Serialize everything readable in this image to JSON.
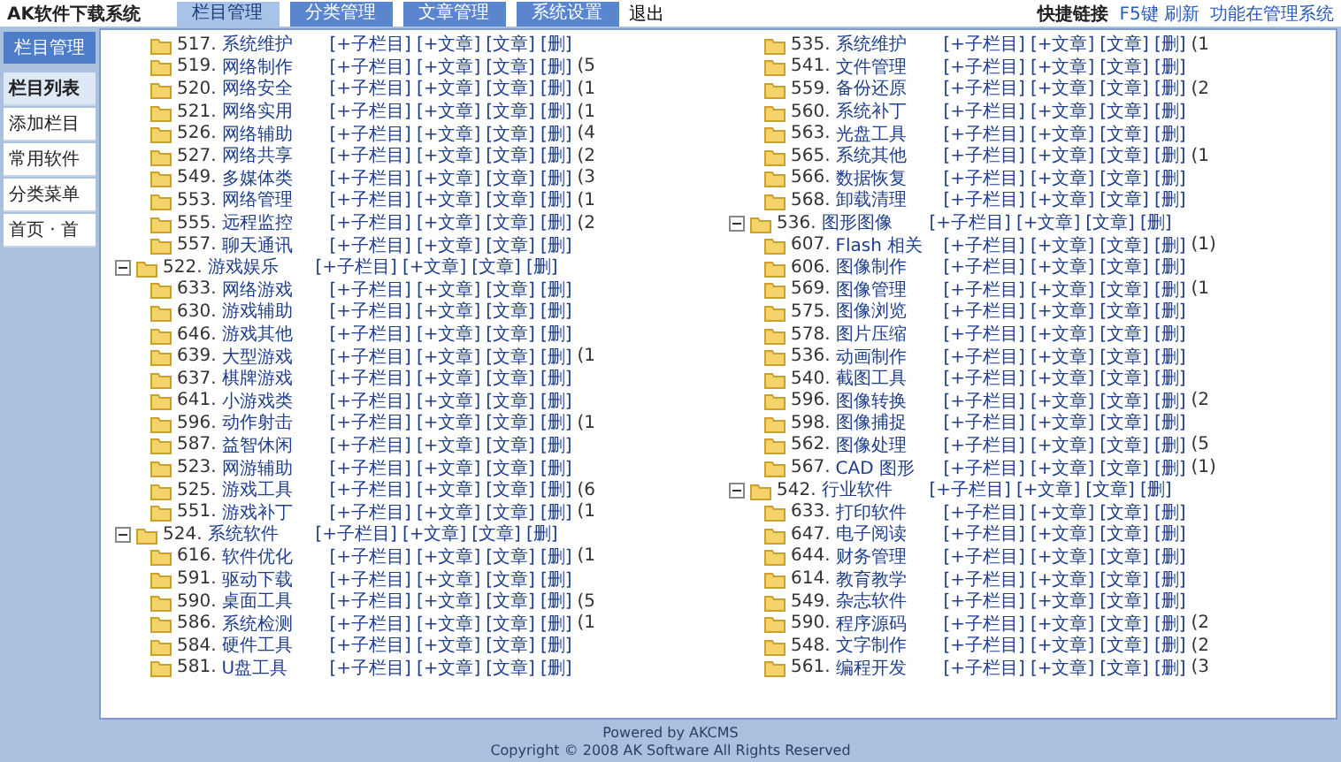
{
  "header": {
    "title": "AK软件下载系统",
    "tabs": [
      {
        "label": "栏目管理",
        "selected": true
      },
      {
        "label": "分类管理",
        "selected": false
      },
      {
        "label": "文章管理",
        "selected": false
      },
      {
        "label": "系统设置",
        "selected": false
      }
    ],
    "logout": "退出",
    "quick_label": "快捷链接",
    "quick_links": [
      "F5键 刷新",
      "功能在管理系统"
    ]
  },
  "sidebar": {
    "heading": "栏目管理",
    "items": [
      {
        "label": "栏目列表",
        "selected": true
      },
      {
        "label": "添加栏目",
        "selected": false
      },
      {
        "label": "常用软件",
        "selected": false
      },
      {
        "label": "分类菜单",
        "selected": false
      },
      {
        "label": "首页 · 首",
        "selected": false
      }
    ]
  },
  "tree": [
    {
      "children": [
        {
          "num": "517.",
          "name": "系统维护",
          "actions": [
            "[+子栏目]",
            "[+文章]",
            "[文章]",
            "[删]"
          ]
        },
        {
          "num": "519.",
          "name": "网络制作",
          "actions": [
            "[+子栏目]",
            "[+文章]",
            "[文章]",
            "[删]"
          ],
          "count": "(5"
        },
        {
          "num": "520.",
          "name": "网络安全",
          "actions": [
            "[+子栏目]",
            "[+文章]",
            "[文章]",
            "[删]"
          ],
          "count": "(1"
        },
        {
          "num": "521.",
          "name": "网络实用",
          "actions": [
            "[+子栏目]",
            "[+文章]",
            "[文章]",
            "[删]"
          ],
          "count": "(1"
        },
        {
          "num": "526.",
          "name": "网络辅助",
          "actions": [
            "[+子栏目]",
            "[+文章]",
            "[文章]",
            "[删]"
          ],
          "count": "(4"
        },
        {
          "num": "527.",
          "name": "网络共享",
          "actions": [
            "[+子栏目]",
            "[+文章]",
            "[文章]",
            "[删]"
          ],
          "count": "(2"
        },
        {
          "num": "549.",
          "name": "多媒体类",
          "actions": [
            "[+子栏目]",
            "[+文章]",
            "[文章]",
            "[删]"
          ],
          "count": "(3"
        },
        {
          "num": "553.",
          "name": "网络管理",
          "actions": [
            "[+子栏目]",
            "[+文章]",
            "[文章]",
            "[删]"
          ],
          "count": "(1"
        },
        {
          "num": "555.",
          "name": "远程监控",
          "actions": [
            "[+子栏目]",
            "[+文章]",
            "[文章]",
            "[删]"
          ],
          "count": "(2"
        },
        {
          "num": "557.",
          "name": "聊天通讯",
          "actions": [
            "[+子栏目]",
            "[+文章]",
            "[文章]",
            "[删]"
          ]
        }
      ]
    },
    {
      "num": "522.",
      "name": "游戏娱乐",
      "expanded": true,
      "actions": [
        "[+子栏目]",
        "[+文章]",
        "[文章]",
        "[删]"
      ],
      "children": [
        {
          "num": "633.",
          "name": "网络游戏",
          "actions": [
            "[+子栏目]",
            "[+文章]",
            "[文章]",
            "[删]"
          ]
        },
        {
          "num": "630.",
          "name": "游戏辅助",
          "actions": [
            "[+子栏目]",
            "[+文章]",
            "[文章]",
            "[删]"
          ]
        },
        {
          "num": "646.",
          "name": "游戏其他",
          "actions": [
            "[+子栏目]",
            "[+文章]",
            "[文章]",
            "[删]"
          ]
        },
        {
          "num": "639.",
          "name": "大型游戏",
          "actions": [
            "[+子栏目]",
            "[+文章]",
            "[文章]",
            "[删]"
          ],
          "count": "(1"
        },
        {
          "num": "637.",
          "name": "棋牌游戏",
          "actions": [
            "[+子栏目]",
            "[+文章]",
            "[文章]",
            "[删]"
          ]
        },
        {
          "num": "641.",
          "name": "小游戏类",
          "actions": [
            "[+子栏目]",
            "[+文章]",
            "[文章]",
            "[删]"
          ]
        },
        {
          "num": "596.",
          "name": "动作射击",
          "actions": [
            "[+子栏目]",
            "[+文章]",
            "[文章]",
            "[删]"
          ],
          "count": "(1"
        },
        {
          "num": "587.",
          "name": "益智休闲",
          "actions": [
            "[+子栏目]",
            "[+文章]",
            "[文章]",
            "[删]"
          ]
        },
        {
          "num": "523.",
          "name": "网游辅助",
          "actions": [
            "[+子栏目]",
            "[+文章]",
            "[文章]",
            "[删]"
          ]
        },
        {
          "num": "525.",
          "name": "游戏工具",
          "actions": [
            "[+子栏目]",
            "[+文章]",
            "[文章]",
            "[删]"
          ],
          "count": "(6"
        },
        {
          "num": "551.",
          "name": "游戏补丁",
          "actions": [
            "[+子栏目]",
            "[+文章]",
            "[文章]",
            "[删]"
          ],
          "count": "(1"
        }
      ]
    },
    {
      "num": "524.",
      "name": "系统软件",
      "expanded": true,
      "actions": [
        "[+子栏目]",
        "[+文章]",
        "[文章]",
        "[删]"
      ],
      "children": [
        {
          "num": "616.",
          "name": "软件优化",
          "actions": [
            "[+子栏目]",
            "[+文章]",
            "[文章]",
            "[删]"
          ],
          "count": "(1"
        },
        {
          "num": "591.",
          "name": "驱动下载",
          "actions": [
            "[+子栏目]",
            "[+文章]",
            "[文章]",
            "[删]"
          ]
        },
        {
          "num": "590.",
          "name": "桌面工具",
          "actions": [
            "[+子栏目]",
            "[+文章]",
            "[文章]",
            "[删]"
          ],
          "count": "(5"
        },
        {
          "num": "586.",
          "name": "系统检测",
          "actions": [
            "[+子栏目]",
            "[+文章]",
            "[文章]",
            "[删]"
          ],
          "count": "(1"
        },
        {
          "num": "584.",
          "name": "硬件工具",
          "actions": [
            "[+子栏目]",
            "[+文章]",
            "[文章]",
            "[删]"
          ]
        },
        {
          "num": "581.",
          "name": "U盘工具",
          "actions": [
            "[+子栏目]",
            "[+文章]",
            "[文章]",
            "[删]"
          ]
        },
        {
          "num": "535.",
          "name": "系统维护",
          "actions": [
            "[+子栏目]",
            "[+文章]",
            "[文章]",
            "[删]"
          ],
          "count": "(1"
        },
        {
          "num": "541.",
          "name": "文件管理",
          "actions": [
            "[+子栏目]",
            "[+文章]",
            "[文章]",
            "[删]"
          ]
        },
        {
          "num": "559.",
          "name": "备份还原",
          "actions": [
            "[+子栏目]",
            "[+文章]",
            "[文章]",
            "[删]"
          ],
          "count": "(2"
        },
        {
          "num": "560.",
          "name": "系统补丁",
          "actions": [
            "[+子栏目]",
            "[+文章]",
            "[文章]",
            "[删]"
          ]
        },
        {
          "num": "563.",
          "name": "光盘工具",
          "actions": [
            "[+子栏目]",
            "[+文章]",
            "[文章]",
            "[删]"
          ]
        },
        {
          "num": "565.",
          "name": "系统其他",
          "actions": [
            "[+子栏目]",
            "[+文章]",
            "[文章]",
            "[删]"
          ],
          "count": "(1"
        },
        {
          "num": "566.",
          "name": "数据恢复",
          "actions": [
            "[+子栏目]",
            "[+文章]",
            "[文章]",
            "[删]"
          ]
        },
        {
          "num": "568.",
          "name": "卸载清理",
          "actions": [
            "[+子栏目]",
            "[+文章]",
            "[文章]",
            "[删]"
          ]
        }
      ]
    },
    {
      "num": "536.",
      "name": "图形图像",
      "expanded": true,
      "actions": [
        "[+子栏目]",
        "[+文章]",
        "[文章]",
        "[删]"
      ],
      "children": [
        {
          "num": "607.",
          "name": "Flash 相关",
          "actions": [
            "[+子栏目]",
            "[+文章]",
            "[文章]",
            "[删]"
          ],
          "count": "(1)"
        },
        {
          "num": "606.",
          "name": "图像制作",
          "actions": [
            "[+子栏目]",
            "[+文章]",
            "[文章]",
            "[删]"
          ]
        },
        {
          "num": "569.",
          "name": "图像管理",
          "actions": [
            "[+子栏目]",
            "[+文章]",
            "[文章]",
            "[删]"
          ],
          "count": "(1"
        },
        {
          "num": "575.",
          "name": "图像浏览",
          "actions": [
            "[+子栏目]",
            "[+文章]",
            "[文章]",
            "[删]"
          ]
        },
        {
          "num": "578.",
          "name": "图片压缩",
          "actions": [
            "[+子栏目]",
            "[+文章]",
            "[文章]",
            "[删]"
          ]
        },
        {
          "num": "536.",
          "name": "动画制作",
          "actions": [
            "[+子栏目]",
            "[+文章]",
            "[文章]",
            "[删]"
          ]
        },
        {
          "num": "540.",
          "name": "截图工具",
          "actions": [
            "[+子栏目]",
            "[+文章]",
            "[文章]",
            "[删]"
          ]
        },
        {
          "num": "596.",
          "name": "图像转换",
          "actions": [
            "[+子栏目]",
            "[+文章]",
            "[文章]",
            "[删]"
          ],
          "count": "(2"
        },
        {
          "num": "598.",
          "name": "图像捕捉",
          "actions": [
            "[+子栏目]",
            "[+文章]",
            "[文章]",
            "[删]"
          ]
        },
        {
          "num": "562.",
          "name": "图像处理",
          "actions": [
            "[+子栏目]",
            "[+文章]",
            "[文章]",
            "[删]"
          ],
          "count": "(5"
        },
        {
          "num": "567.",
          "name": "CAD 图形",
          "actions": [
            "[+子栏目]",
            "[+文章]",
            "[文章]",
            "[删]"
          ],
          "count": "(1)"
        }
      ]
    },
    {
      "num": "542.",
      "name": "行业软件",
      "expanded": true,
      "actions": [
        "[+子栏目]",
        "[+文章]",
        "[文章]",
        "[删]"
      ],
      "children": [
        {
          "num": "633.",
          "name": "打印软件",
          "actions": [
            "[+子栏目]",
            "[+文章]",
            "[文章]",
            "[删]"
          ]
        },
        {
          "num": "647.",
          "name": "电子阅读",
          "actions": [
            "[+子栏目]",
            "[+文章]",
            "[文章]",
            "[删]"
          ]
        },
        {
          "num": "644.",
          "name": "财务管理",
          "actions": [
            "[+子栏目]",
            "[+文章]",
            "[文章]",
            "[删]"
          ]
        },
        {
          "num": "614.",
          "name": "教育教学",
          "actions": [
            "[+子栏目]",
            "[+文章]",
            "[文章]",
            "[删]"
          ]
        },
        {
          "num": "549.",
          "name": "杂志软件",
          "actions": [
            "[+子栏目]",
            "[+文章]",
            "[文章]",
            "[删]"
          ]
        },
        {
          "num": "590.",
          "name": "程序源码",
          "actions": [
            "[+子栏目]",
            "[+文章]",
            "[文章]",
            "[删]"
          ],
          "count": "(2"
        },
        {
          "num": "548.",
          "name": "文字制作",
          "actions": [
            "[+子栏目]",
            "[+文章]",
            "[文章]",
            "[删]"
          ],
          "count": "(2"
        },
        {
          "num": "561.",
          "name": "编程开发",
          "actions": [
            "[+子栏目]",
            "[+文章]",
            "[文章]",
            "[删]"
          ],
          "count": "(3"
        }
      ]
    }
  ],
  "footer": {
    "lines": [
      "Powered by AKCMS",
      "Copyright © 2008 AK Software All Rights Reserved"
    ]
  }
}
